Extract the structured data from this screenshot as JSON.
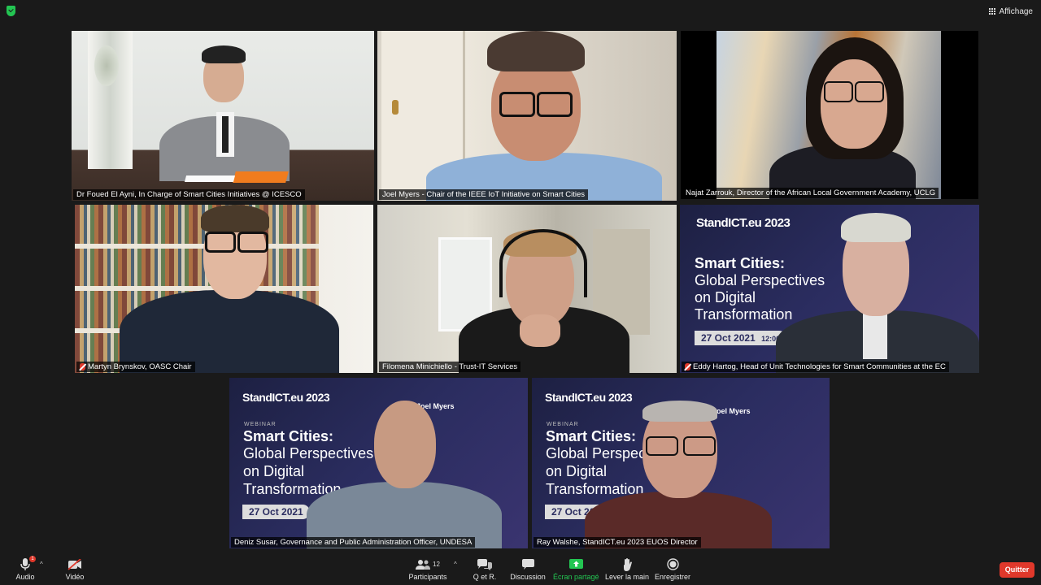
{
  "view_button": {
    "label": "Affichage",
    "icon": "grid-icon"
  },
  "participants_tiles": [
    {
      "name": "Dr Foued El Ayni, In Charge of Smart Cities  Initiatives @ ICESCO",
      "active": true,
      "muted": false
    },
    {
      "name": "Joel Myers - Chair of the IEEE IoT Initiative on Smart Cities",
      "active": false,
      "muted": false
    },
    {
      "name": "Najat Zarrouk, Director of the African Local Government Academy, UCLG",
      "active": false,
      "muted": false
    },
    {
      "name": "Martyn Brynskov, OASC Chair",
      "active": false,
      "muted": true
    },
    {
      "name": "Filomena Minichiello - Trust-IT Services",
      "active": false,
      "muted": false
    },
    {
      "name": "Eddy Hartog, Head of Unit Technologies for Smart Communities at the EC",
      "active": false,
      "muted": true
    },
    {
      "name": "Deniz Susar, Governance and Public Administration Officer, UNDESA",
      "active": false,
      "muted": false
    },
    {
      "name": "Ray Walshe, StandICT.eu 2023 EUOS Director",
      "active": false,
      "muted": false
    }
  ],
  "slide": {
    "logo": "StandICT.eu 2023",
    "webinar": "WEBINAR",
    "title_line1": "Smart Cities:",
    "title_line2": "Global Perspectives",
    "title_line3": "on Digital",
    "title_line4": "Transformation",
    "date": "27 Oct 2021",
    "time": "12:00",
    "speaker_name": "Joel Myers"
  },
  "toolbar": {
    "audio": {
      "label": "Audio",
      "badge": "1"
    },
    "video": {
      "label": "Vidéo"
    },
    "participants": {
      "label": "Participants",
      "count": "12"
    },
    "qa": {
      "label": "Q et R."
    },
    "chat": {
      "label": "Discussion"
    },
    "share": {
      "label": "Écran partagé"
    },
    "raise_hand": {
      "label": "Lever la main"
    },
    "record": {
      "label": "Enregistrer"
    },
    "quit": {
      "label": "Quitter"
    }
  },
  "colors": {
    "active_speaker_outline": "#c9ec4e",
    "quit_button": "#e0382b",
    "share_green": "#23c552",
    "background": "#1a1a1a"
  }
}
